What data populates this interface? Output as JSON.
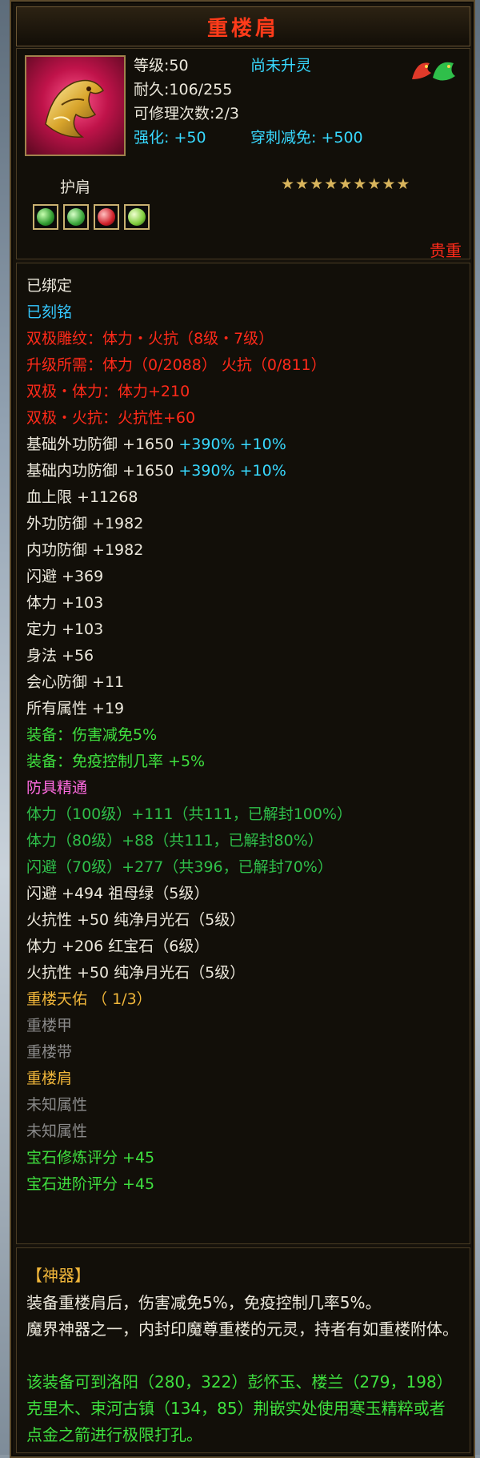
{
  "title": "重楼肩",
  "header": {
    "level_label": "等级:50",
    "spirit_status": "尚未升灵",
    "durability": "耐久:106/255",
    "repair_count": "可修理次数:2/3",
    "strengthen": "强化: +50",
    "pierce_reduce": "穿刺减免: +500",
    "item_type": "护肩",
    "star_count": 9,
    "rarity": "贵重"
  },
  "icons": {
    "item": "golden-dragon-shoulder-icon",
    "badge": "spirit-dragon-icon",
    "gems": [
      "green-gem-icon",
      "green-gem-icon",
      "red-gem-icon",
      "green-gem-icon"
    ]
  },
  "colors": {
    "title": "#ff3b1a",
    "rarity": "#ff2a1a",
    "attribute_white": "#ece8dc",
    "attribute_red": "#ff2a1a",
    "attribute_cyan": "#38d9ff",
    "attribute_green": "#3fe03f",
    "attribute_gold": "#f0b63a",
    "attribute_gray": "#8a8a8a"
  },
  "attributes": [
    {
      "text": "已绑定",
      "color": "white"
    },
    {
      "text": "已刻铭",
      "color": "blue"
    },
    {
      "text": "双极雕纹：体力・火抗（8级・7级）",
      "color": "red"
    },
    {
      "text": "升级所需：体力（0/2088）  火抗（0/811）",
      "color": "red"
    },
    {
      "text": "双极・体力：体力+210",
      "color": "red"
    },
    {
      "text": "双极・火抗：火抗性+60",
      "color": "red"
    },
    {
      "text": "基础外功防御 +1650 ",
      "extra": "+390% +10%",
      "color": "white"
    },
    {
      "text": "基础内功防御 +1650 ",
      "extra": "+390% +10%",
      "color": "white"
    },
    {
      "text": "血上限 +11268",
      "color": "white"
    },
    {
      "text": "外功防御 +1982",
      "color": "white"
    },
    {
      "text": "内功防御 +1982",
      "color": "white"
    },
    {
      "text": "闪避 +369",
      "color": "white"
    },
    {
      "text": "体力 +103",
      "color": "white"
    },
    {
      "text": "定力 +103",
      "color": "white"
    },
    {
      "text": "身法 +56",
      "color": "white"
    },
    {
      "text": "会心防御 +11",
      "color": "white"
    },
    {
      "text": "所有属性 +19",
      "color": "white"
    },
    {
      "text": "装备：伤害减免5%",
      "color": "green"
    },
    {
      "text": "装备：免疫控制几率 +5%",
      "color": "green"
    },
    {
      "text": "防具精通",
      "color": "pink"
    },
    {
      "text": "体力（100级）+111（共111，已解封100%）",
      "color": "dgreen"
    },
    {
      "text": "体力（80级）+88（共111，已解封80%）",
      "color": "dgreen"
    },
    {
      "text": "闪避（70级）+277（共396，已解封70%）",
      "color": "dgreen"
    },
    {
      "text": "闪避 +494 祖母绿（5级）",
      "color": "white"
    },
    {
      "text": "火抗性 +50 纯净月光石（5级）",
      "color": "white"
    },
    {
      "text": "体力 +206 红宝石（6级）",
      "color": "white"
    },
    {
      "text": "火抗性 +50 纯净月光石（5级）",
      "color": "white"
    },
    {
      "text": "重楼天佑 （ 1/3）",
      "color": "gold"
    },
    {
      "text": "重楼甲",
      "color": "gray"
    },
    {
      "text": "重楼带",
      "color": "gray"
    },
    {
      "text": "重楼肩",
      "color": "gold"
    },
    {
      "text": "未知属性",
      "color": "gray"
    },
    {
      "text": "未知属性",
      "color": "gray"
    },
    {
      "text": "宝石修炼评分 +45",
      "color": "green"
    },
    {
      "text": "宝石进阶评分 +45",
      "color": "green"
    }
  ],
  "lore": {
    "title": "【神器】",
    "effect": "装备重楼肩后，伤害减免5%，免疫控制几率5%。",
    "description": "魔界神器之一，内封印魔尊重楼的元灵，持者有如重楼附体。",
    "location": "该装备可到洛阳（280，322）彭怀玉、楼兰（279，198）克里木、束河古镇（134，85）荆嵌实处使用寒玉精粹或者点金之箭进行极限打孔。"
  }
}
